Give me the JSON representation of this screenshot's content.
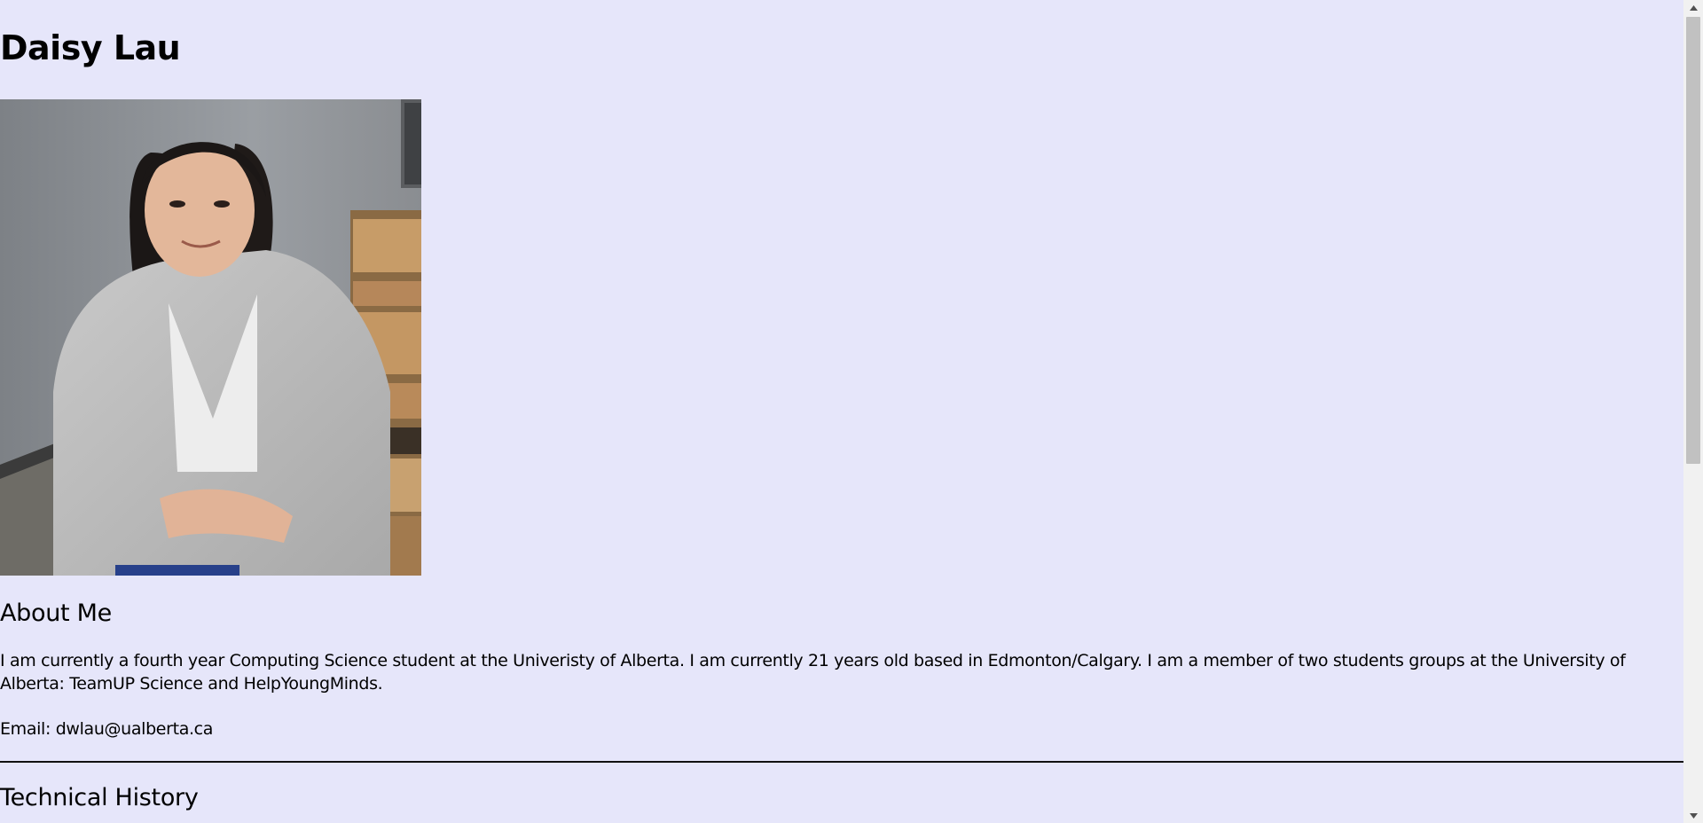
{
  "profile": {
    "name": "Daisy Lau",
    "photo_alt": "Photo of Daisy Lau"
  },
  "about": {
    "heading": "About Me",
    "text": "I am currently a fourth year Computing Science student at the Univeristy of Alberta. I am currently 21 years old based in Edmonton/Calgary. I am a member of two students groups at the University of Alberta: TeamUP Science and HelpYoungMinds.",
    "email": "Email: dwlau@ualberta.ca"
  },
  "technical": {
    "heading": "Technical History"
  },
  "colors": {
    "background": "#e6e6fa",
    "text": "#000000",
    "divider": "#111111",
    "scrollbar_track": "#f1f1f1",
    "scrollbar_thumb": "#c1c1c1"
  },
  "icons": {
    "scroll_up": "triangle-up-icon",
    "scroll_down": "triangle-down-icon"
  }
}
